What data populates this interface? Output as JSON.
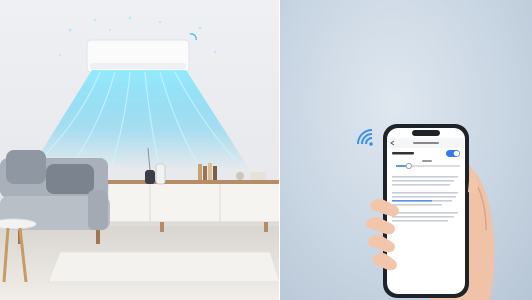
{
  "scene": {
    "left_panel": "living-room-with-air-conditioner",
    "right_panel": "hand-holding-phone-with-app"
  },
  "colors": {
    "airflow": "#4fd6ff",
    "wall": "#eef0f3",
    "floor": "#e9e6e1",
    "sofa": "#a9b0b9",
    "phone_bg": "#c9d6e3",
    "toggle_on": "#2f7bf6",
    "wifi_icon": "#3d8ff0"
  },
  "phone": {
    "header_title": "",
    "toggle_state": "on",
    "slider_level": 0.2
  }
}
